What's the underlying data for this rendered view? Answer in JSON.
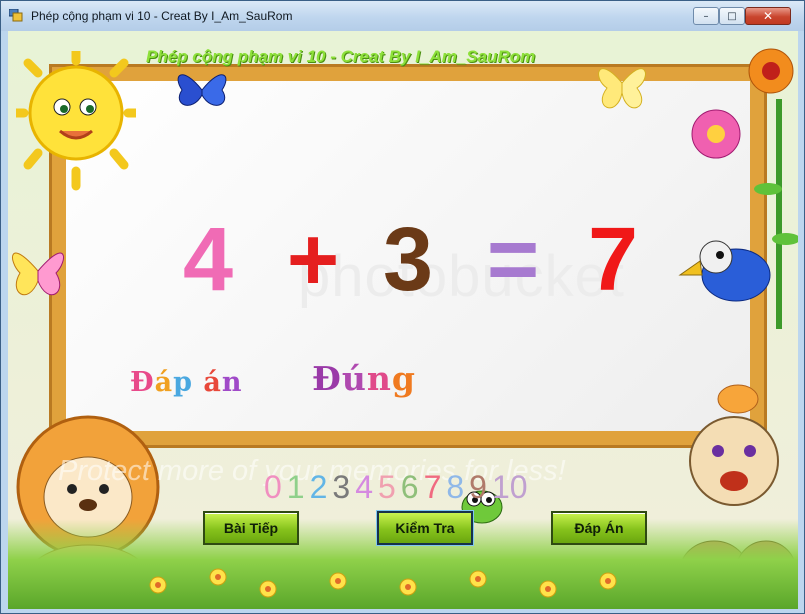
{
  "window": {
    "title": "Phép cộng phạm vi 10 - Creat By I_Am_SauRom",
    "buttons": {
      "minimize": "–",
      "maximize": "□",
      "close": "✕"
    }
  },
  "banner": "Phép cộng phạm vi 10 - Creat By I_Am_SauRom",
  "equation": {
    "a": "4",
    "op": "+",
    "b": "3",
    "eq": "=",
    "result": "7"
  },
  "answer_label": "Đáp án",
  "answer_status": "Đúng",
  "digits": [
    "0",
    "1",
    "2",
    "3",
    "4",
    "5",
    "6",
    "7",
    "8",
    "9",
    "10"
  ],
  "digit_colors": [
    "#f08fc0",
    "#8fd08a",
    "#62b5e6",
    "#7a7a7a",
    "#d58ae0",
    "#f0a0b0",
    "#8fbf7a",
    "#f06a80",
    "#8fb8e8",
    "#b07a6a",
    "#c0a0d0"
  ],
  "watermarks": {
    "main": "photobucket",
    "protect": "Protect more of your memories for less!"
  },
  "buttons": {
    "next": "Bài Tiếp",
    "check": "Kiểm Tra",
    "answer": "Đáp Án"
  },
  "colors": {
    "accent": "#86c21c",
    "frame": "#e0a23c"
  }
}
